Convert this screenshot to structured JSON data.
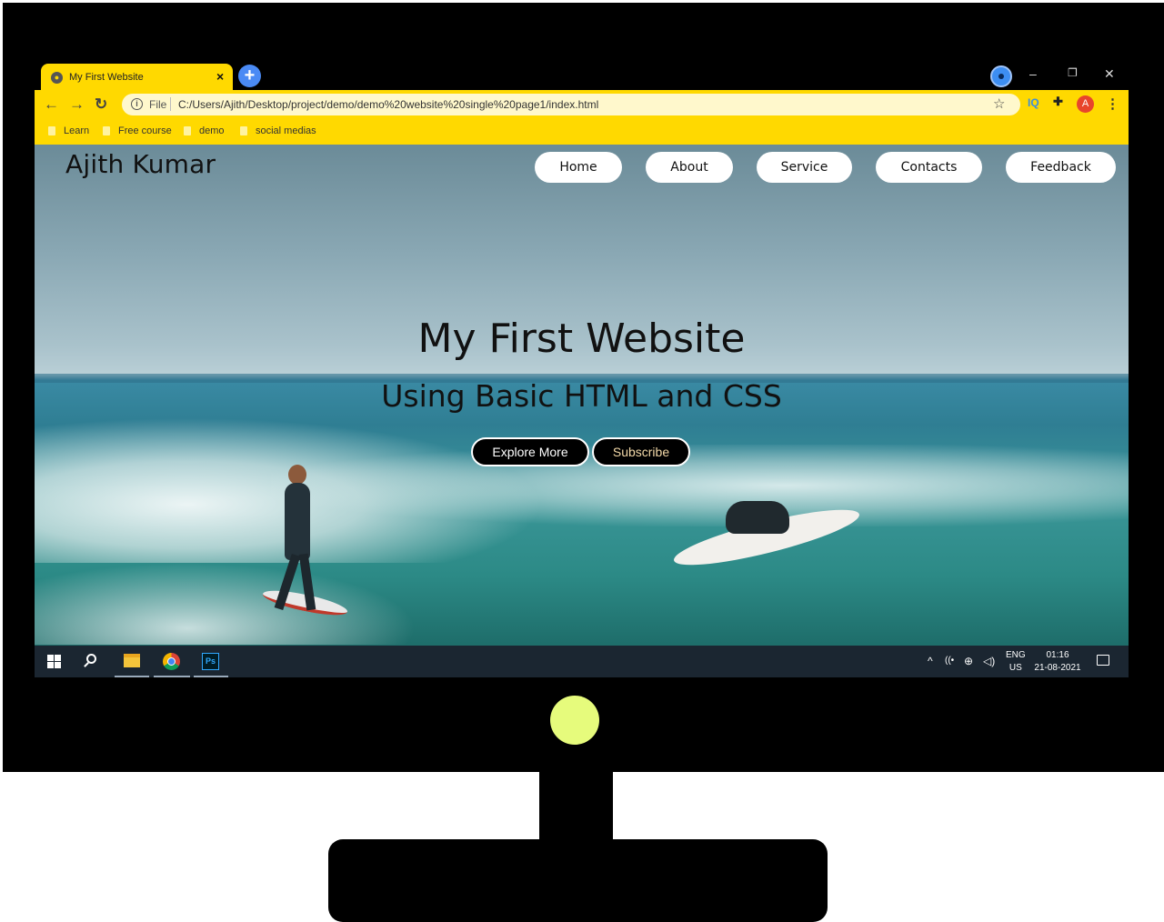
{
  "browser": {
    "tab_title": "My First Website",
    "tab_close": "×",
    "new_tab": "+",
    "scheme_label": "File",
    "url": "C:/Users/Ajith/Desktop/project/demo/demo%20website%20single%20page1/index.html",
    "avatar_letter": "A",
    "extension_label": "IQ",
    "bookmarks": [
      "Learn",
      "Free course",
      "demo",
      "social medias"
    ],
    "window_controls": [
      "–",
      "❐",
      "✕"
    ]
  },
  "site": {
    "logo": "Ajith Kumar",
    "nav": [
      "Home",
      "About",
      "Service",
      "Contacts",
      "Feedback"
    ],
    "hero_title": "My First Website",
    "hero_subtitle": "Using Basic HTML and CSS",
    "buttons": {
      "explore": "Explore More",
      "subscribe": "Subscribe"
    }
  },
  "taskbar": {
    "language": "ENG",
    "region": "US",
    "time": "01:16",
    "date": "21-08-2021"
  },
  "colors": {
    "browser_accent": "#ffd900",
    "power_led": "#e6fb7c",
    "new_tab_button": "#4a8af4"
  },
  "icons": [
    "windows-start-icon",
    "search-icon",
    "file-explorer-icon",
    "chrome-icon",
    "photoshop-icon",
    "star-icon",
    "puzzle-icon",
    "kebab-menu-icon",
    "info-icon",
    "back-icon",
    "forward-icon",
    "reload-icon",
    "notification-icon",
    "wifi-icon",
    "globe-icon",
    "volume-icon",
    "chevron-up-icon"
  ]
}
